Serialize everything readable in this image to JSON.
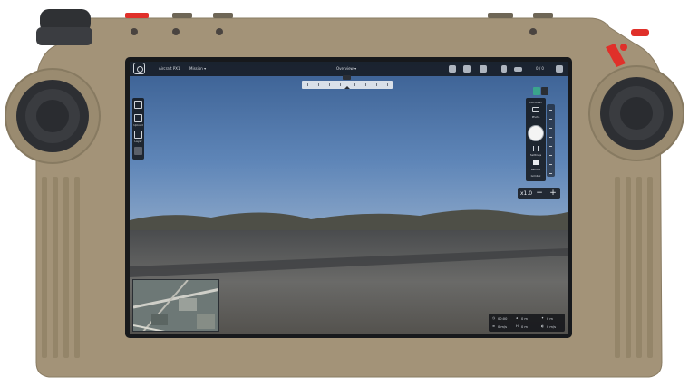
{
  "device": {
    "body_color": "#a39378",
    "accent_color": "#e0302a",
    "screen_bezel_color": "#17191c"
  },
  "app": {
    "brand_icon": "camera-aperture-icon",
    "aircraft_label": "Aircraft PX1",
    "mission_label": "Mission ▾",
    "view_selector": "Overview ▾",
    "status_icons": [
      "shield-icon",
      "target-icon",
      "satellite-icon",
      "signal-icon",
      "battery-icon",
      "speaker-icon"
    ],
    "status_value": "0 / 0"
  },
  "compass": {
    "heading_label": "N"
  },
  "left_toolbar": {
    "items": [
      {
        "icon": "route-icon",
        "label": ""
      },
      {
        "icon": "upload-icon",
        "label": "Upload"
      },
      {
        "icon": "layers-icon",
        "label": "Layer"
      },
      {
        "icon": "more-icon",
        "label": ""
      }
    ]
  },
  "camera_panel": {
    "title": "PAYLOAD",
    "photo_label": "Photo",
    "settings_label": "Settings",
    "record_label": "Record",
    "extra_label": "Gimbal",
    "mode_active_color": "#3aa58c"
  },
  "zoom": {
    "value": "x1.0",
    "minus": "−",
    "plus": "+"
  },
  "telemetry": {
    "rows": [
      [
        {
          "icon": "clock-icon",
          "value": "00:00"
        },
        {
          "icon": "altitude-icon",
          "value": "0 m"
        },
        {
          "icon": "distance-icon",
          "value": "0 m"
        }
      ],
      [
        {
          "icon": "speed-icon",
          "value": "0 m/s"
        },
        {
          "icon": "height-icon",
          "value": "0 m"
        },
        {
          "icon": "vspeed-icon",
          "value": "0 m/s"
        }
      ]
    ]
  }
}
